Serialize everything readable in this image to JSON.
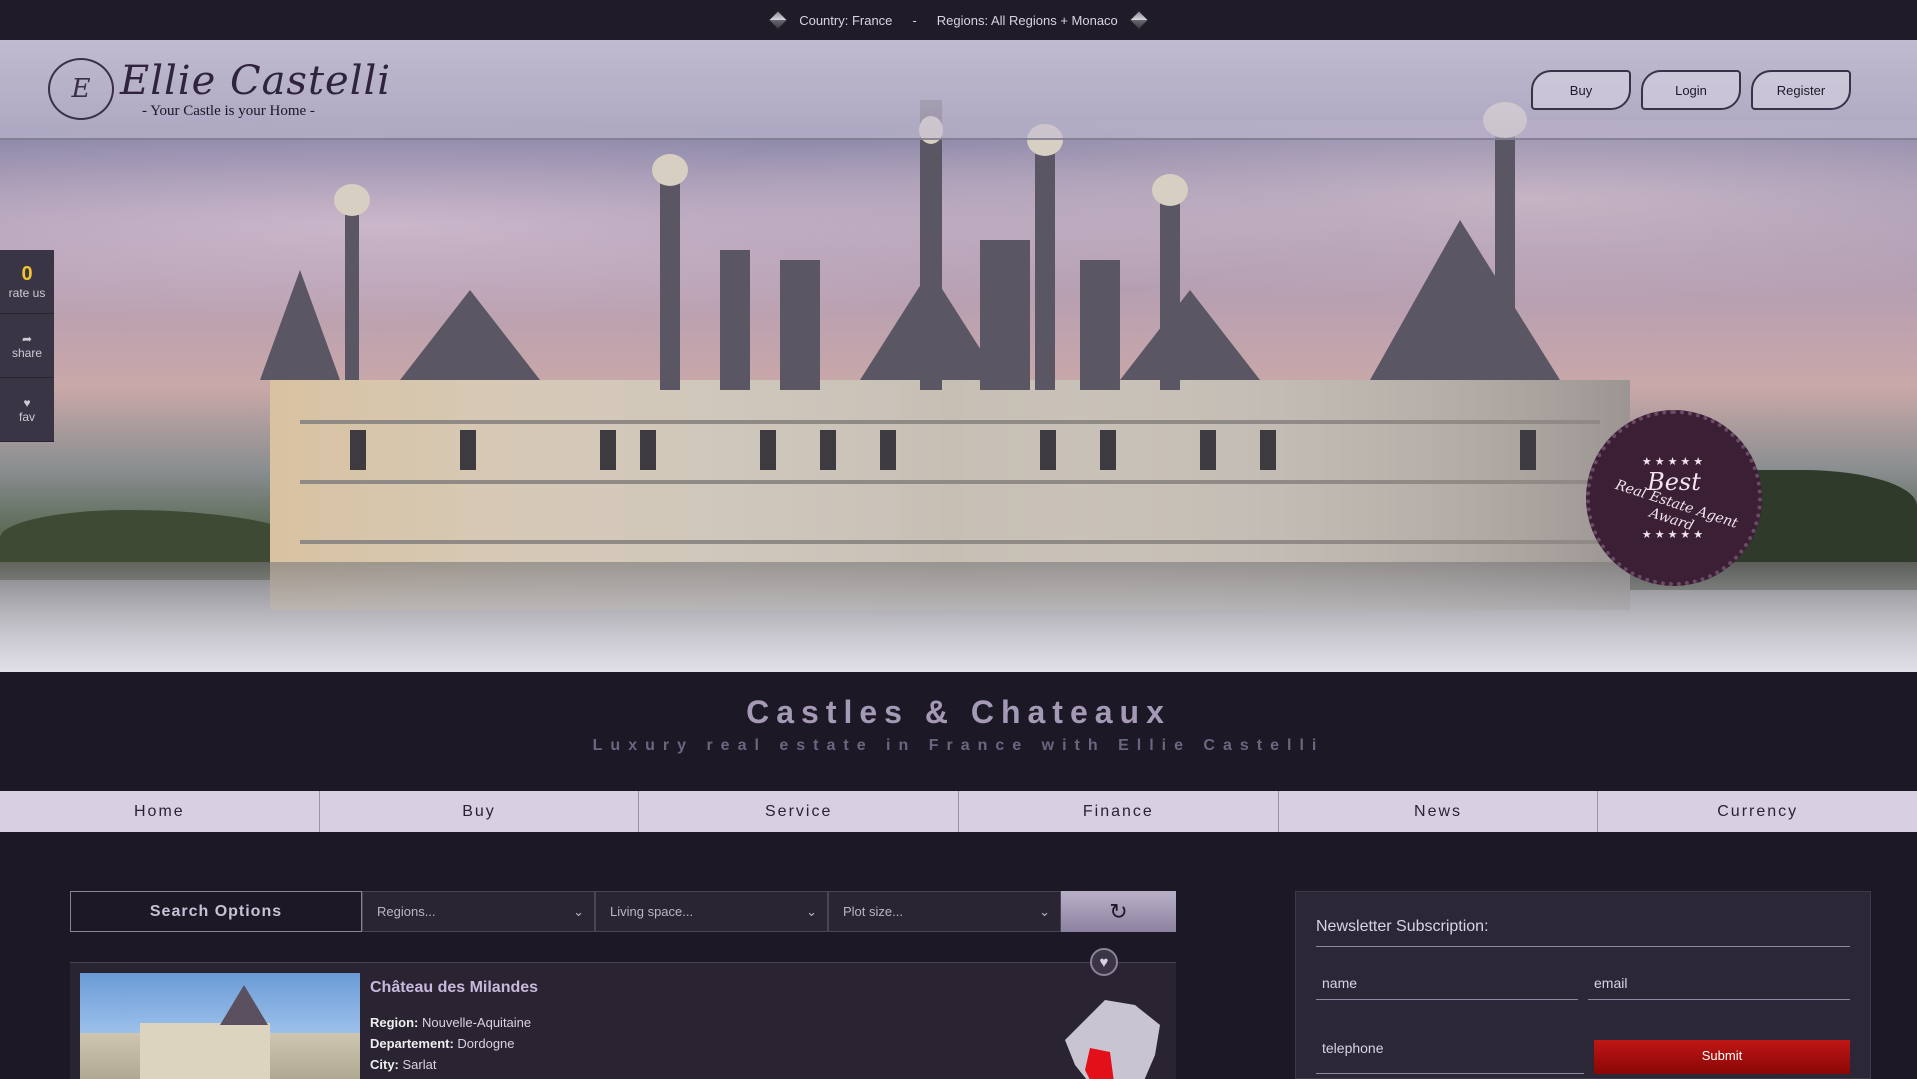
{
  "topbar": {
    "country": "Country: France",
    "separator": "-",
    "regions": "Regions: All Regions + Monaco"
  },
  "brand": {
    "name": "Ellie Castelli",
    "tagline": "- Your Castle is your Home -",
    "mark": "E"
  },
  "auth": {
    "buy": "Buy",
    "login": "Login",
    "register": "Register"
  },
  "side": {
    "rating_count": "0",
    "rate_label": "rate us",
    "share_label": "share",
    "fav_label": "fav"
  },
  "award": {
    "best": "Best",
    "sub": "Real Estate Agent Award",
    "stars": "★★★★★"
  },
  "hero": {
    "title": "Castles & Chateaux",
    "subtitle": "Luxury real estate in France with Ellie Castelli"
  },
  "nav": {
    "items": [
      "Home",
      "Buy",
      "Service",
      "Finance",
      "News",
      "Currency"
    ]
  },
  "search": {
    "label": "Search Options",
    "regions": "Regions...",
    "living_space": "Living space...",
    "plot_size": "Plot size..."
  },
  "listing": {
    "name": "Château des Milandes",
    "region_label": "Region:",
    "region": "Nouvelle-Aquitaine",
    "departement_label": "Departement:",
    "departement": "Dordogne",
    "city_label": "City:",
    "city": "Sarlat"
  },
  "newsletter": {
    "title": "Newsletter Subscription:",
    "name_placeholder": "name",
    "email_placeholder": "email",
    "telephone_placeholder": "telephone",
    "submit": "Submit"
  },
  "colors": {
    "background": "#1d1826",
    "accent": "#a59ab6",
    "nav_bg": "#d8d0e0",
    "submit": "#b01010",
    "rating": "#f1c232"
  }
}
